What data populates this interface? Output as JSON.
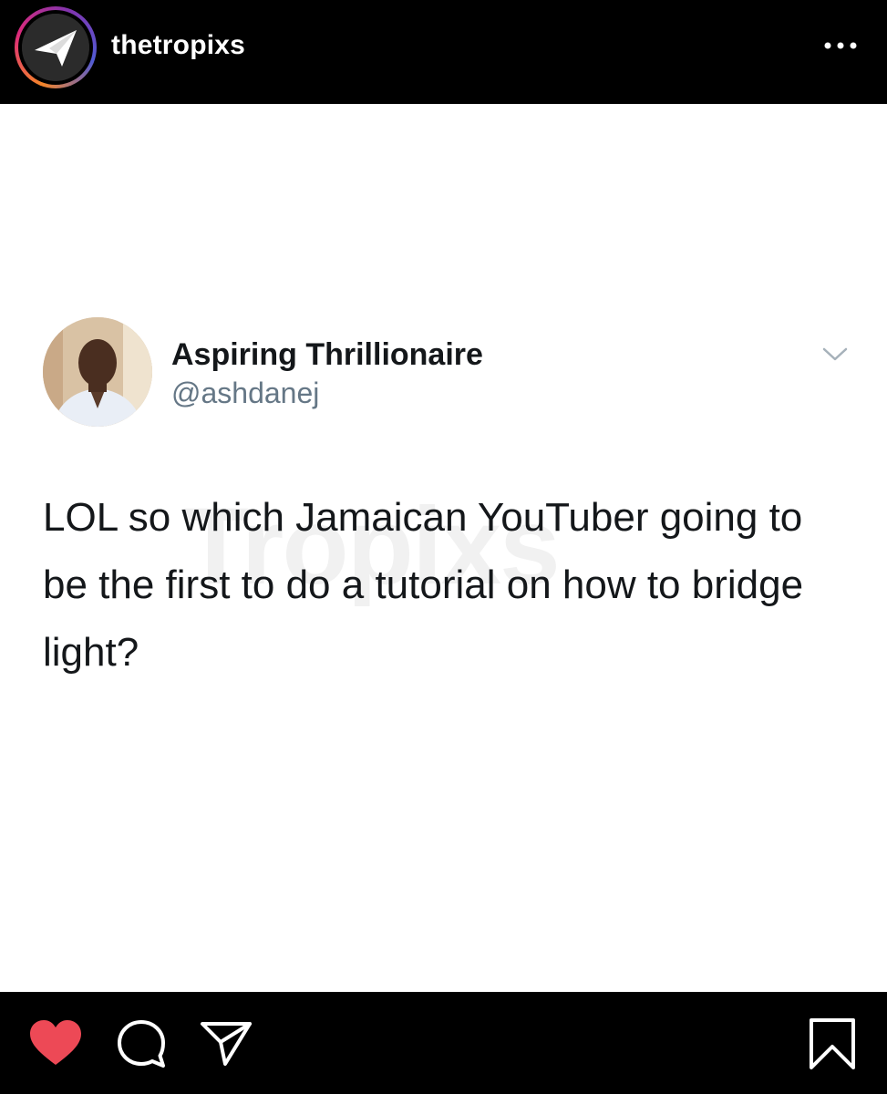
{
  "header": {
    "username": "thetropixs",
    "avatar_icon": "paper-plane-logo-icon",
    "more_icon": "more-dots-icon"
  },
  "tweet": {
    "display_name": "Aspiring Thrillionaire",
    "handle": "@ashdanej",
    "text": "LOL so which Jamaican YouTuber going to be the first to do a tutorial on how to bridge light?",
    "watermark": "Tropixs",
    "menu_icon": "chevron-down-icon"
  },
  "footer": {
    "like_icon": "heart-icon",
    "comment_icon": "comment-icon",
    "share_icon": "send-icon",
    "save_icon": "bookmark-icon"
  },
  "colors": {
    "background": "#000000",
    "post_background": "#ffffff",
    "like_active": "#ed4956",
    "name_text": "#14171a",
    "handle_text": "#657786"
  }
}
